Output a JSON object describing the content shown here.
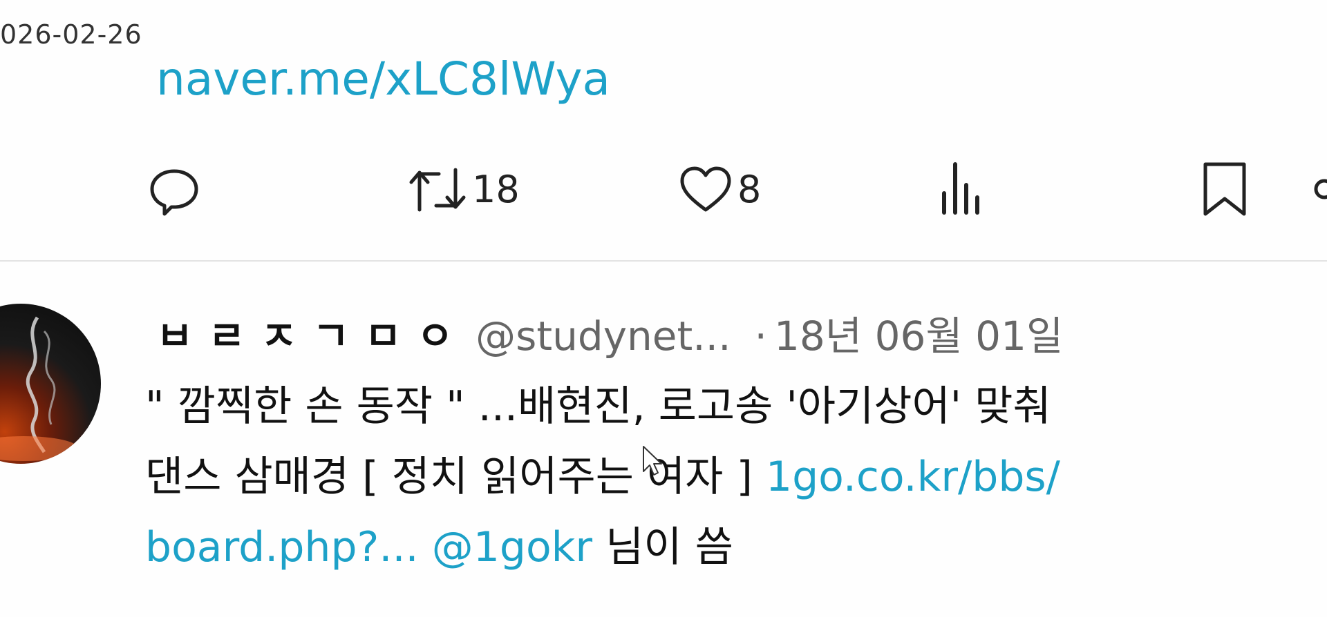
{
  "date_stamp": "026-02-26",
  "previous_tweet": {
    "link_text": "naver.me/xLC8lWya",
    "actions": {
      "reply_icon": "reply-icon",
      "retweet_icon": "retweet-icon",
      "retweet_count": "18",
      "like_icon": "heart-icon",
      "like_count": "8",
      "views_icon": "views-bar-icon",
      "bookmark_icon": "bookmark-icon",
      "share_icon": "share-icon"
    }
  },
  "tweet": {
    "display_name": "ㅂㄹㅈㄱㅁㅇ",
    "handle": "@studynet...",
    "separator": "·",
    "timestamp": "18년 06월 01일",
    "avatar_icon": "avatar",
    "body": {
      "line1": "\" 깜찍한 손 동작 \" ...배현진, 로고송 '아기상어' 맞춰",
      "line2_text": "댄스 삼매경 [ 정치 읽어주는 여자 ] ",
      "line2_link": "1go.co.kr/bbs/",
      "line3_link": "board.php?...",
      "line3_mention": "@1gokr",
      "line3_text": " 님이 씀"
    }
  },
  "colors": {
    "link": "#1da1c8",
    "text": "#111111",
    "muted": "#666666",
    "divider": "#e3e3e3"
  }
}
